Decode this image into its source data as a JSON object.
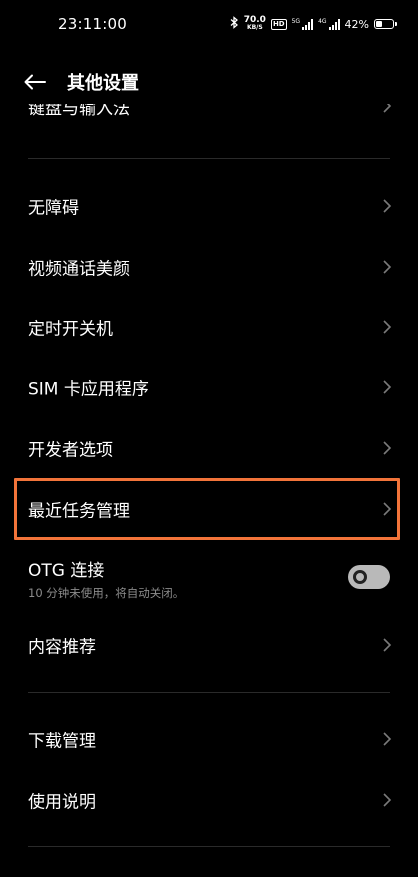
{
  "status_bar": {
    "time": "23:11:00",
    "net_speed": "70.0",
    "net_speed_unit": "KB/S",
    "hd_label": "HD",
    "sim1_tag": "5G",
    "sim2_tag": "4G",
    "battery_percent": "42%",
    "battery_level": 0.42
  },
  "header": {
    "title": "其他设置"
  },
  "cut_item": {
    "label": "键盘与输入法"
  },
  "items": [
    {
      "label": "无障碍"
    },
    {
      "label": "视频通话美颜"
    },
    {
      "label": "定时开关机"
    },
    {
      "label": "SIM 卡应用程序"
    },
    {
      "label": "开发者选项"
    },
    {
      "label": "最近任务管理"
    }
  ],
  "otg": {
    "title": "OTG 连接",
    "subtitle": "10 分钟未使用，将自动关闭。",
    "enabled": false
  },
  "content_recommend": {
    "label": "内容推荐"
  },
  "bottom_items": [
    {
      "label": "下载管理"
    },
    {
      "label": "使用说明"
    }
  ],
  "colors": {
    "background": "#000000",
    "highlight": "#f2743a",
    "secondary_text": "#8c8c8c"
  }
}
